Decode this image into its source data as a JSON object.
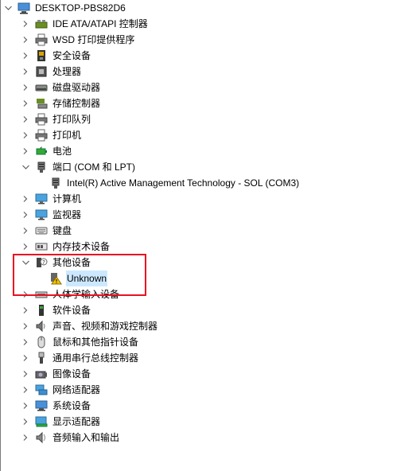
{
  "device_tree": {
    "root": {
      "label": "DESKTOP-PBS82D6",
      "icon": "computer-icon",
      "expanded": true
    },
    "categories": [
      {
        "label": "IDE ATA/ATAPI 控制器",
        "icon": "ide-controller-icon"
      },
      {
        "label": "WSD 打印提供程序",
        "icon": "printer-icon"
      },
      {
        "label": "安全设备",
        "icon": "security-device-icon"
      },
      {
        "label": "处理器",
        "icon": "processor-icon"
      },
      {
        "label": "磁盘驱动器",
        "icon": "disk-drive-icon"
      },
      {
        "label": "存储控制器",
        "icon": "storage-controller-icon"
      },
      {
        "label": "打印队列",
        "icon": "printer-icon"
      },
      {
        "label": "打印机",
        "icon": "printer-icon"
      },
      {
        "label": "电池",
        "icon": "battery-icon"
      },
      {
        "label": "端口 (COM 和 LPT)",
        "icon": "port-icon",
        "expanded": true,
        "children": [
          {
            "label": "Intel(R) Active Management Technology - SOL (COM3)",
            "icon": "port-icon"
          }
        ]
      },
      {
        "label": "计算机",
        "icon": "monitor-icon"
      },
      {
        "label": "监视器",
        "icon": "monitor-icon"
      },
      {
        "label": "键盘",
        "icon": "keyboard-icon"
      },
      {
        "label": "内存技术设备",
        "icon": "memory-device-icon"
      },
      {
        "label": "其他设备",
        "icon": "other-devices-icon",
        "expanded": true,
        "children": [
          {
            "label": "Unknown",
            "icon": "warning-device-icon",
            "selected": true
          }
        ]
      },
      {
        "label": "人体学输入设备",
        "icon": "hid-icon"
      },
      {
        "label": "软件设备",
        "icon": "software-device-icon"
      },
      {
        "label": "声音、视频和游戏控制器",
        "icon": "sound-icon"
      },
      {
        "label": "鼠标和其他指针设备",
        "icon": "mouse-icon"
      },
      {
        "label": "通用串行总线控制器",
        "icon": "usb-icon"
      },
      {
        "label": "图像设备",
        "icon": "camera-icon"
      },
      {
        "label": "网络适配器",
        "icon": "network-adapter-icon"
      },
      {
        "label": "系统设备",
        "icon": "system-device-icon"
      },
      {
        "label": "显示适配器",
        "icon": "display-adapter-icon"
      },
      {
        "label": "音频输入和输出",
        "icon": "audio-io-icon"
      }
    ]
  },
  "annotation": {
    "color": "#e81123",
    "target": "其他设备 / Unknown"
  },
  "colors": {
    "selection": "#cce8ff",
    "chevron": "#606060"
  }
}
